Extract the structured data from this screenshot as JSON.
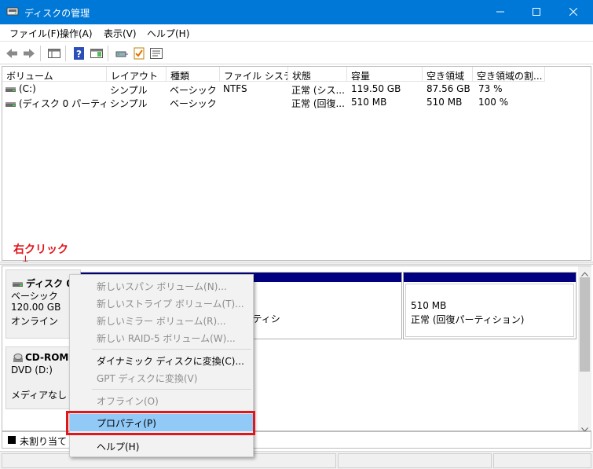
{
  "window": {
    "title": "ディスクの管理",
    "icon": "disk-management-icon",
    "controls": [
      "minimize-icon",
      "maximize-icon",
      "close-icon"
    ],
    "accent": "#0078d7"
  },
  "menubar": {
    "items": [
      "ファイル(F)",
      "操作(A)",
      "表示(V)",
      "ヘルプ(H)"
    ]
  },
  "toolbar": {
    "icons": [
      "back-arrow-icon",
      "forward-arrow-icon",
      "console-tree-icon",
      "help-icon",
      "action-pane-icon",
      "connect-icon",
      "checklist-icon",
      "properties-list-icon"
    ]
  },
  "volumes": {
    "headers": [
      "ボリューム",
      "レイアウト",
      "種類",
      "ファイル システム",
      "状態",
      "容量",
      "空き領域",
      "空き領域の割..."
    ],
    "rows": [
      [
        "(C:)",
        "シンプル",
        "ベーシック",
        "NTFS",
        "正常 (シス...",
        "119.50 GB",
        "87.56 GB",
        "73 %"
      ],
      [
        "(ディスク 0 パーティシ...",
        "シンプル",
        "ベーシック",
        "",
        "正常 (回復...",
        "510 MB",
        "510 MB",
        "100 %"
      ]
    ]
  },
  "annotation": {
    "label": "右クリック",
    "arrow": "↓",
    "color": "#e0161c"
  },
  "disks": {
    "disk0": {
      "name": "ディスク 0",
      "type": "ベーシック",
      "size": "120.00 GB",
      "status": "オンライン",
      "partition_c_status": "ブ, クラッシュ ダンプ, プライマリ パーティシ",
      "partition_recovery_size": "510 MB",
      "partition_recovery_status": "正常 (回復パーティション)"
    },
    "cdrom0": {
      "name": "CD-ROM 0",
      "type": "DVD (D:)",
      "status": "メディアなし"
    }
  },
  "legend": {
    "unallocated": "未割り当て"
  },
  "context_menu": {
    "items": [
      {
        "label": "新しいスパン ボリューム(N)...",
        "enabled": false
      },
      {
        "label": "新しいストライプ ボリューム(T)...",
        "enabled": false
      },
      {
        "label": "新しいミラー ボリューム(R)...",
        "enabled": false
      },
      {
        "label": "新しい RAID-5 ボリューム(W)...",
        "enabled": false
      },
      {
        "label": "ダイナミック ディスクに変換(C)...",
        "enabled": true
      },
      {
        "label": "GPT ディスクに変換(V)",
        "enabled": false
      },
      {
        "label": "オフライン(O)",
        "enabled": false
      },
      {
        "label": "プロパティ(P)",
        "enabled": true,
        "highlighted": true
      },
      {
        "label": "ヘルプ(H)",
        "enabled": true
      }
    ]
  },
  "colors": {
    "partition_header": "#000080",
    "menu_highlight": "#91c9f7",
    "callout_red": "#e0161c"
  }
}
